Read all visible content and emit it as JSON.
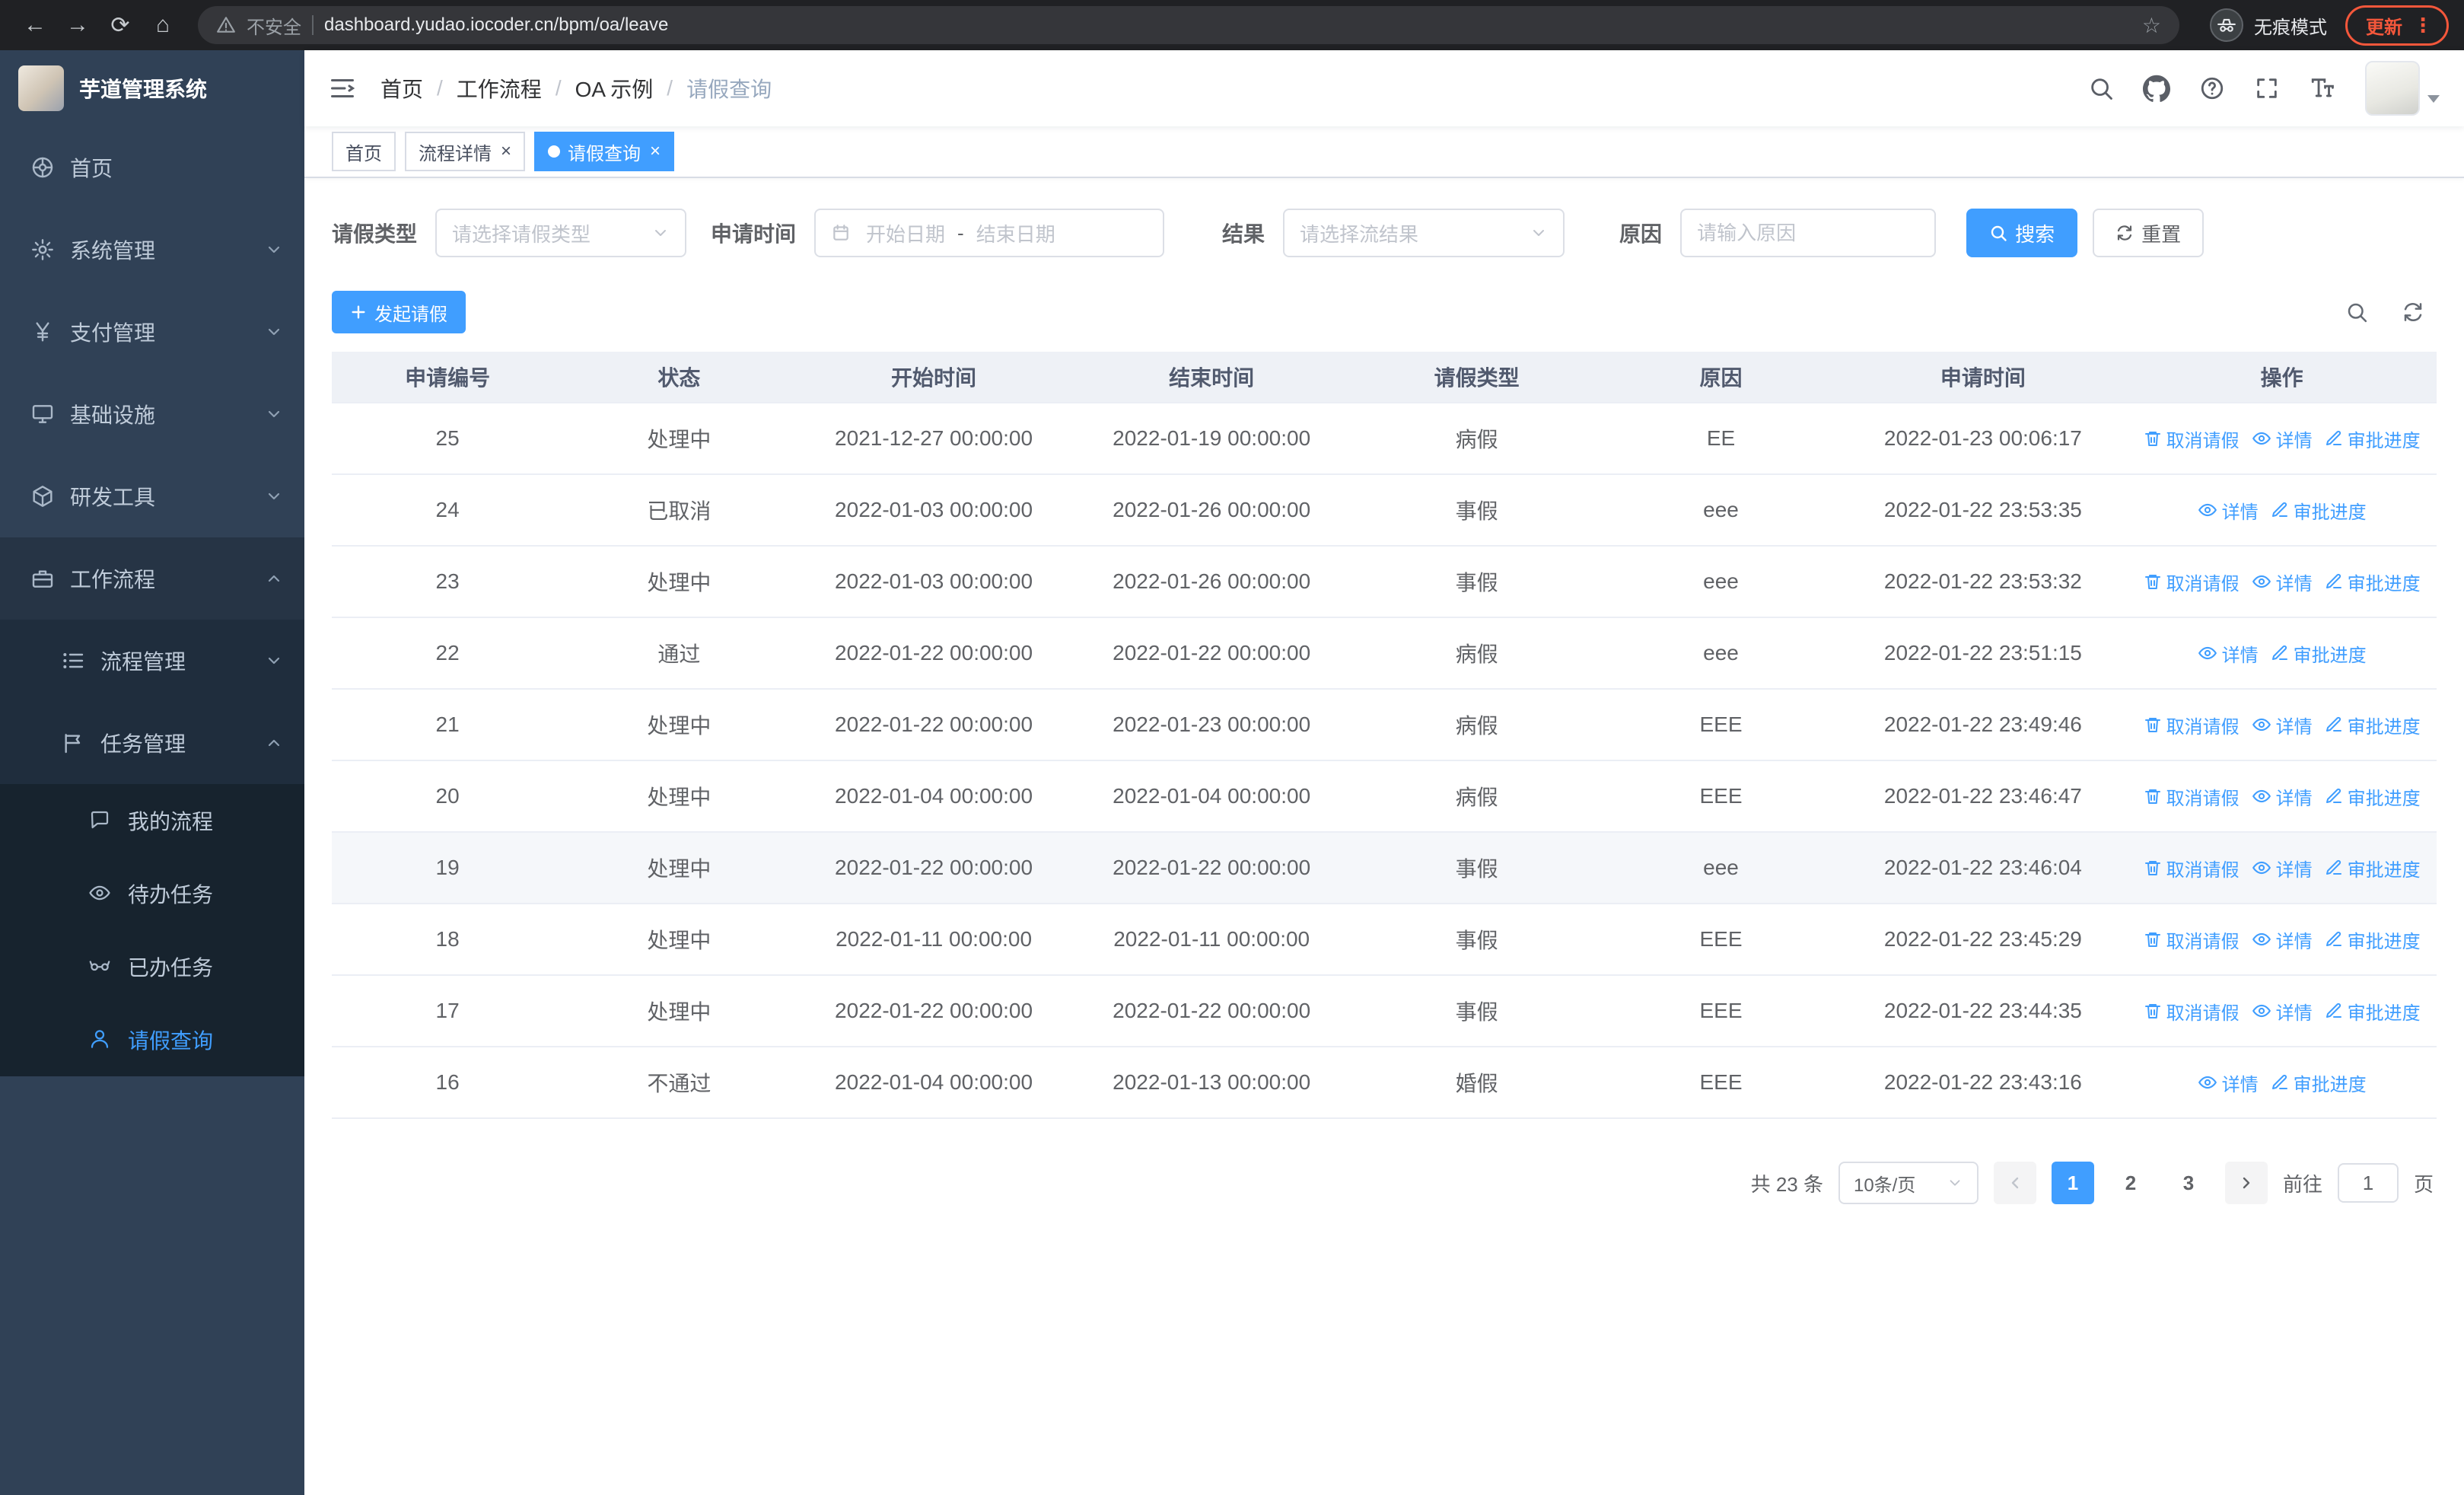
{
  "colors": {
    "primary": "#409eff",
    "sidebar_bg": "#304156",
    "update_pill": "#f4573b"
  },
  "browser": {
    "security_label": "不安全",
    "url": "dashboard.yudao.iocoder.cn/bpm/oa/leave",
    "incognito_label": "无痕模式",
    "update_label": "更新"
  },
  "sidebar": {
    "logo_title": "芋道管理系统",
    "items": [
      {
        "label": "首页"
      },
      {
        "label": "系统管理"
      },
      {
        "label": "支付管理"
      },
      {
        "label": "基础设施"
      },
      {
        "label": "研发工具"
      },
      {
        "label": "工作流程"
      },
      {
        "label": "流程管理"
      },
      {
        "label": "任务管理"
      },
      {
        "label": "我的流程"
      },
      {
        "label": "待办任务"
      },
      {
        "label": "已办任务"
      },
      {
        "label": "请假查询"
      }
    ]
  },
  "header": {
    "breadcrumb": [
      "首页",
      "工作流程",
      "OA 示例",
      "请假查询"
    ]
  },
  "tabs": [
    {
      "label": "首页"
    },
    {
      "label": "流程详情"
    },
    {
      "label": "请假查询"
    }
  ],
  "filters": {
    "leave_type_label": "请假类型",
    "leave_type_placeholder": "请选择请假类型",
    "apply_time_label": "申请时间",
    "start_date_placeholder": "开始日期",
    "range_separator": "-",
    "end_date_placeholder": "结束日期",
    "result_label": "结果",
    "result_placeholder": "请选择流结果",
    "reason_label": "原因",
    "reason_placeholder": "请输入原因",
    "search_label": "搜索",
    "reset_label": "重置"
  },
  "toolbar": {
    "create_label": "发起请假"
  },
  "table": {
    "columns": [
      "申请编号",
      "状态",
      "开始时间",
      "结束时间",
      "请假类型",
      "原因",
      "申请时间",
      "操作"
    ],
    "rows": [
      {
        "id": "25",
        "status": "处理中",
        "start": "2021-12-27 00:00:00",
        "end": "2022-01-19 00:00:00",
        "type": "病假",
        "reason": "EE",
        "apply": "2022-01-23 00:06:17",
        "cancelable": true
      },
      {
        "id": "24",
        "status": "已取消",
        "start": "2022-01-03 00:00:00",
        "end": "2022-01-26 00:00:00",
        "type": "事假",
        "reason": "eee",
        "apply": "2022-01-22 23:53:35",
        "cancelable": false
      },
      {
        "id": "23",
        "status": "处理中",
        "start": "2022-01-03 00:00:00",
        "end": "2022-01-26 00:00:00",
        "type": "事假",
        "reason": "eee",
        "apply": "2022-01-22 23:53:32",
        "cancelable": true
      },
      {
        "id": "22",
        "status": "通过",
        "start": "2022-01-22 00:00:00",
        "end": "2022-01-22 00:00:00",
        "type": "病假",
        "reason": "eee",
        "apply": "2022-01-22 23:51:15",
        "cancelable": false
      },
      {
        "id": "21",
        "status": "处理中",
        "start": "2022-01-22 00:00:00",
        "end": "2022-01-23 00:00:00",
        "type": "病假",
        "reason": "EEE",
        "apply": "2022-01-22 23:49:46",
        "cancelable": true
      },
      {
        "id": "20",
        "status": "处理中",
        "start": "2022-01-04 00:00:00",
        "end": "2022-01-04 00:00:00",
        "type": "病假",
        "reason": "EEE",
        "apply": "2022-01-22 23:46:47",
        "cancelable": true
      },
      {
        "id": "19",
        "status": "处理中",
        "start": "2022-01-22 00:00:00",
        "end": "2022-01-22 00:00:00",
        "type": "事假",
        "reason": "eee",
        "apply": "2022-01-22 23:46:04",
        "cancelable": true,
        "highlighted": true
      },
      {
        "id": "18",
        "status": "处理中",
        "start": "2022-01-11 00:00:00",
        "end": "2022-01-11 00:00:00",
        "type": "事假",
        "reason": "EEE",
        "apply": "2022-01-22 23:45:29",
        "cancelable": true
      },
      {
        "id": "17",
        "status": "处理中",
        "start": "2022-01-22 00:00:00",
        "end": "2022-01-22 00:00:00",
        "type": "事假",
        "reason": "EEE",
        "apply": "2022-01-22 23:44:35",
        "cancelable": true
      },
      {
        "id": "16",
        "status": "不通过",
        "start": "2022-01-04 00:00:00",
        "end": "2022-01-13 00:00:00",
        "type": "婚假",
        "reason": "EEE",
        "apply": "2022-01-22 23:43:16",
        "cancelable": false
      }
    ]
  },
  "actions": {
    "cancel": "取消请假",
    "detail": "详情",
    "progress": "审批进度"
  },
  "pagination": {
    "total_label": "共 23 条",
    "page_size_label": "10条/页",
    "pages": [
      "1",
      "2",
      "3"
    ],
    "goto_label": "前往",
    "goto_value": "1",
    "page_unit_label": "页"
  }
}
